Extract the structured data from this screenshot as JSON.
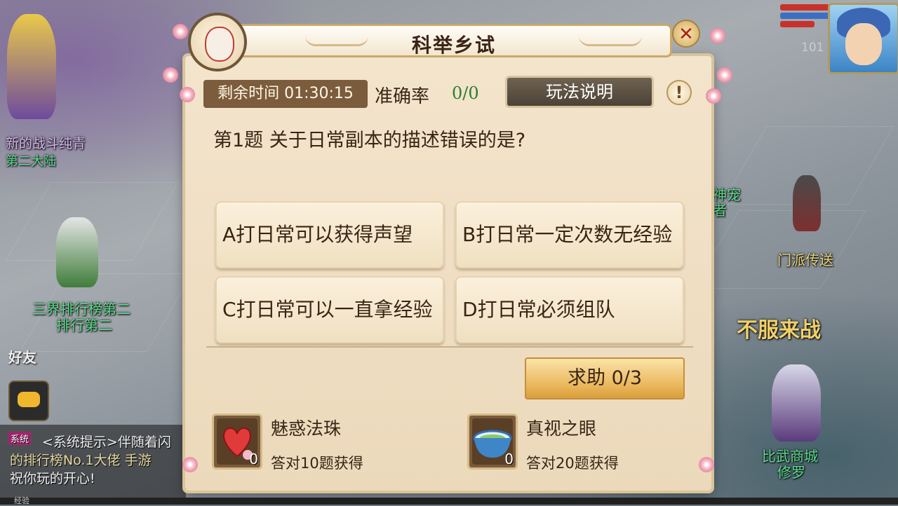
{
  "scene": {
    "npc_labels": [
      "新的战斗纯青",
      "第二大陆",
      "三界排行榜第二",
      "排行第二",
      "门派传送",
      "比武商城",
      "修罗",
      "不服来战",
      "神宠",
      "者"
    ],
    "friends_label": "好友",
    "level": "101",
    "exp_label": "经验",
    "chat_lines": [
      "<系统提示>伴随着闪",
      "的排行榜No.1大佬 手游",
      "祝你玩的开心!"
    ],
    "chat_tag": "系统"
  },
  "dialog": {
    "title": "科举乡试",
    "close_symbol": "✕",
    "timer_label": "剩余时间",
    "timer_value": "01:30:15",
    "accuracy_label": "准确率",
    "accuracy_value": "0/0",
    "rules_button": "玩法说明",
    "help_symbol": "!",
    "question_number": "第1题",
    "question_text": "关于日常副本的描述错误的是?",
    "options": [
      {
        "letter": "A",
        "text": "打日常可以获得声望"
      },
      {
        "letter": "B",
        "text": "打日常一定次数无经验"
      },
      {
        "letter": "C",
        "text": "打日常可以一直拿经验"
      },
      {
        "letter": "D",
        "text": "打日常必须组队"
      }
    ],
    "seek_help_label": "求助",
    "seek_help_count": "0/3",
    "rewards": [
      {
        "name": "魅惑法珠",
        "condition": "答对10题获得",
        "count": "0",
        "icon": "heart-orb-icon"
      },
      {
        "name": "真视之眼",
        "condition": "答对20题获得",
        "count": "0",
        "icon": "bowl-icon"
      }
    ]
  },
  "colors": {
    "accent_brown": "#7b5c3c",
    "accuracy_green": "#2f7d2f",
    "button_gold": "#e9b65a"
  }
}
